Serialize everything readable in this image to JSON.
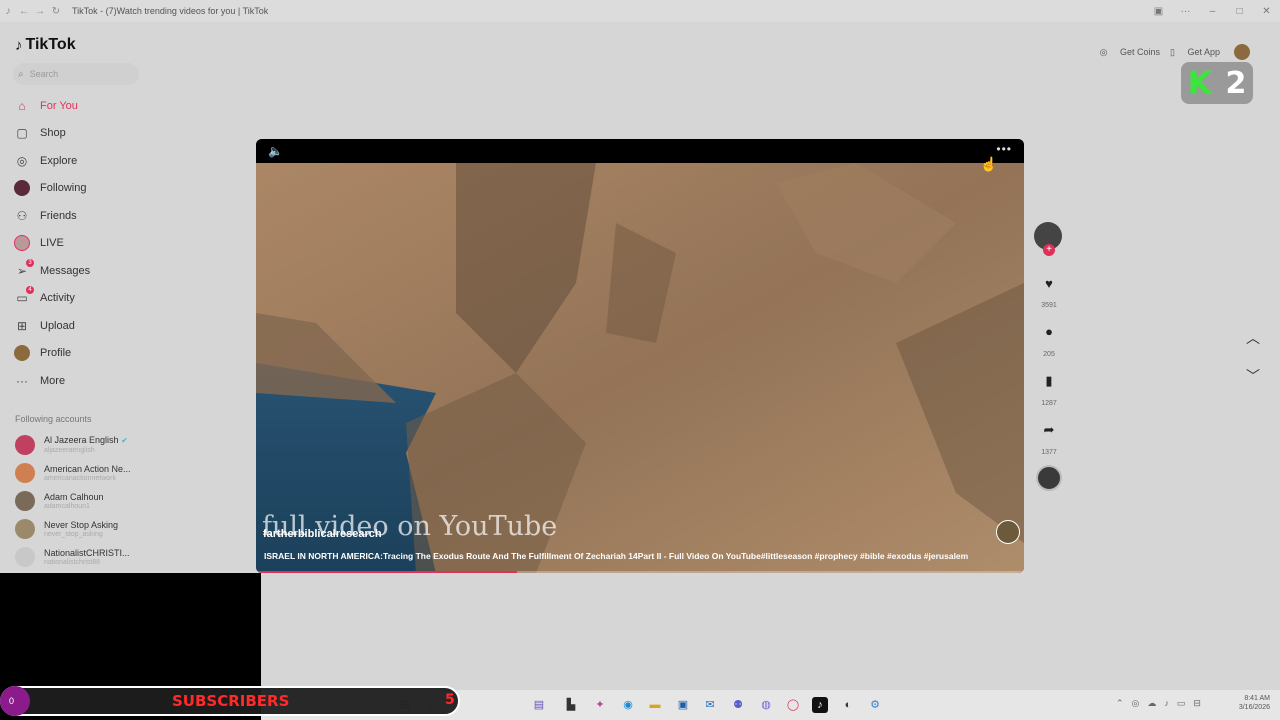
{
  "browser": {
    "title": "TikTok - (7)Watch trending videos for you | TikTok"
  },
  "sidebar": {
    "logo": "TikTok",
    "search_placeholder": "Search",
    "items": [
      {
        "label": "For You",
        "icon": "home-icon",
        "active": true
      },
      {
        "label": "Shop",
        "icon": "shop-bag-icon"
      },
      {
        "label": "Explore",
        "icon": "compass-icon"
      },
      {
        "label": "Following",
        "icon": "following-avatar-icon"
      },
      {
        "label": "Friends",
        "icon": "friends-icon"
      },
      {
        "label": "LIVE",
        "icon": "live-avatar-icon"
      },
      {
        "label": "Messages",
        "icon": "messages-icon",
        "badge": "3"
      },
      {
        "label": "Activity",
        "icon": "activity-icon",
        "badge": "4"
      },
      {
        "label": "Upload",
        "icon": "upload-icon"
      },
      {
        "label": "Profile",
        "icon": "profile-avatar-icon"
      },
      {
        "label": "More",
        "icon": "more-dots-icon"
      }
    ],
    "following_header": "Following accounts",
    "accounts": [
      {
        "name": "Al Jazeera English",
        "handle": "aljazeeraenglish",
        "verified": true
      },
      {
        "name": "American Action Ne...",
        "handle": "americanactionnetwork"
      },
      {
        "name": "Adam Calhoun",
        "handle": "adamcalhoun1"
      },
      {
        "name": "Never Stop Asking",
        "handle": "never_stop_asking"
      },
      {
        "name": "NationalistCHRISTI...",
        "handle": "nationalistchrist88"
      }
    ]
  },
  "topbar": {
    "get_coins": "Get Coins",
    "get_app": "Get App"
  },
  "badge": {
    "letter": "K",
    "number": "2"
  },
  "video": {
    "overlay_text": "full video on YouTube",
    "username": "fartherbiblicalresearch",
    "caption": "ISRAEL IN NORTH AMERICA:Tracing The Exodus Route And The Fulfillment Of Zechariah 14Part II - Full Video On YouTube#littleseason #prophecy #bible #exodus #jerusalem",
    "progress": 0.34
  },
  "actions": {
    "likes": "3591",
    "comments": "205",
    "saves": "1287",
    "shares": "1377"
  },
  "overlay": {
    "subscribers_label": "SUBSCRIBERS",
    "subscribers_count": "5",
    "bubble_text": "0"
  },
  "tray": {
    "time": "8:41 AM",
    "date": "3/16/2026"
  }
}
